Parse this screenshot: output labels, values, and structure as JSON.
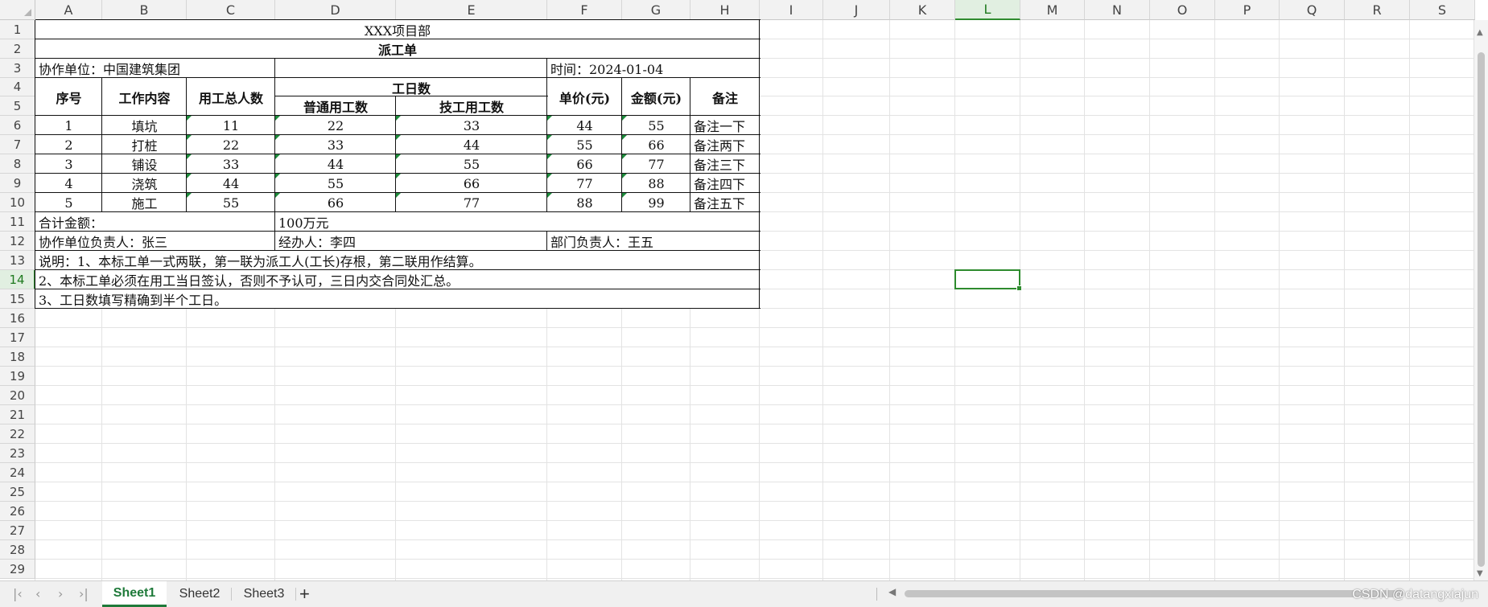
{
  "columns": [
    "A",
    "B",
    "C",
    "D",
    "E",
    "F",
    "G",
    "H",
    "I",
    "J",
    "K",
    "L",
    "M",
    "N",
    "O",
    "P",
    "Q",
    "R",
    "S"
  ],
  "rows": [
    "1",
    "2",
    "3",
    "4",
    "5",
    "6",
    "7",
    "8",
    "9",
    "10",
    "11",
    "12",
    "13",
    "14",
    "15",
    "16",
    "17",
    "18",
    "19",
    "20",
    "21",
    "22",
    "23",
    "24",
    "25",
    "26",
    "27",
    "28",
    "29"
  ],
  "active_cell": {
    "column": "L",
    "row": "14"
  },
  "sheet": {
    "title": "XXX项目部",
    "form_name": "派工单",
    "partner_unit": "协作单位：中国建筑集团",
    "date": "时间：2024-01-04",
    "headers": {
      "seq": "序号",
      "content": "工作内容",
      "total_workers": "用工总人数",
      "workdays": "工日数",
      "normal_days": "普通用工数",
      "skilled_days": "技工用工数",
      "unit_price": "单价(元)",
      "amount": "金额(元)",
      "remark": "备注"
    },
    "data_rows": [
      {
        "seq": "1",
        "content": "填坑",
        "total": "11",
        "normal": "22",
        "skilled": "33",
        "price": "44",
        "amount": "55",
        "remark": "备注一下"
      },
      {
        "seq": "2",
        "content": "打桩",
        "total": "22",
        "normal": "33",
        "skilled": "44",
        "price": "55",
        "amount": "66",
        "remark": "备注两下"
      },
      {
        "seq": "3",
        "content": "铺设",
        "total": "33",
        "normal": "44",
        "skilled": "55",
        "price": "66",
        "amount": "77",
        "remark": "备注三下"
      },
      {
        "seq": "4",
        "content": "浇筑",
        "total": "44",
        "normal": "55",
        "skilled": "66",
        "price": "77",
        "amount": "88",
        "remark": "备注四下"
      },
      {
        "seq": "5",
        "content": "施工",
        "total": "55",
        "normal": "66",
        "skilled": "77",
        "price": "88",
        "amount": "99",
        "remark": "备注五下"
      }
    ],
    "total_label": "合计金额：",
    "total_value": "100万元",
    "partner_lead": "协作单位负责人：张三",
    "handler": "经办人：李四",
    "dept_lead": "部门负责人：王五",
    "note1": "说明：1、本标工单一式两联，第一联为派工人(工长)存根，第二联用作结算。",
    "note2": "2、本标工单必须在用工当日签认，否则不予认可，三日内交合同处汇总。",
    "note3": "3、工日数填写精确到半个工日。"
  },
  "tabs": [
    {
      "label": "Sheet1",
      "active": true
    },
    {
      "label": "Sheet2",
      "active": false
    },
    {
      "label": "Sheet3",
      "active": false
    }
  ],
  "add_sheet_label": "+",
  "watermark": "CSDN @datangxiajun",
  "colors": {
    "accent": "#2e8b2e",
    "tab_active": "#1f7a3a",
    "error_triangle": "#1e8b3c"
  }
}
